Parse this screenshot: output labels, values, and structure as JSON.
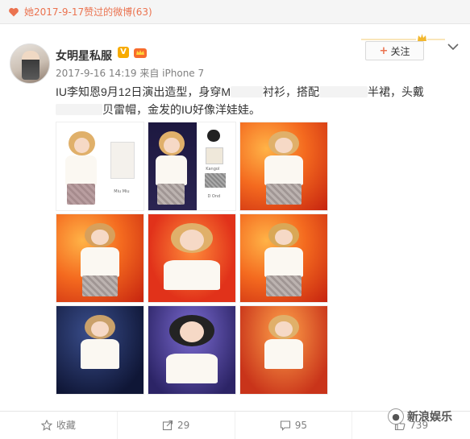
{
  "topbar": {
    "liked_text": "她2017-9-17赞过的微博(63)",
    "icon": "heart-icon",
    "accent": "#eb7350"
  },
  "post": {
    "author": "女明星私服",
    "verified_badge": "V",
    "follow_label": "关注",
    "follow_prefix": "+",
    "timestamp": "2017-9-16 14:19",
    "source_prefix": "来自",
    "source": "iPhone 7",
    "text_part1": "IU李知恩9月12日演出造型，身穿M",
    "text_part2": "衬衫，搭配",
    "text_part3": "半裙，头戴",
    "text_part4": "贝雷帽，金发的IU好像洋娃娃。"
  },
  "images": [
    {
      "caption_a": "",
      "caption_b": "Miu Miu"
    },
    {
      "caption_a": "Kangol",
      "caption_b": "D Ond"
    },
    {},
    {},
    {},
    {},
    {},
    {},
    {}
  ],
  "actions": {
    "favorite_label": "收藏",
    "share_count": "29",
    "comment_count": "95",
    "like_count": "739"
  },
  "watermark": {
    "text": "新浪娱乐"
  },
  "colors": {
    "accent": "#eb7350",
    "meta_gray": "#808080",
    "text": "#333333"
  }
}
